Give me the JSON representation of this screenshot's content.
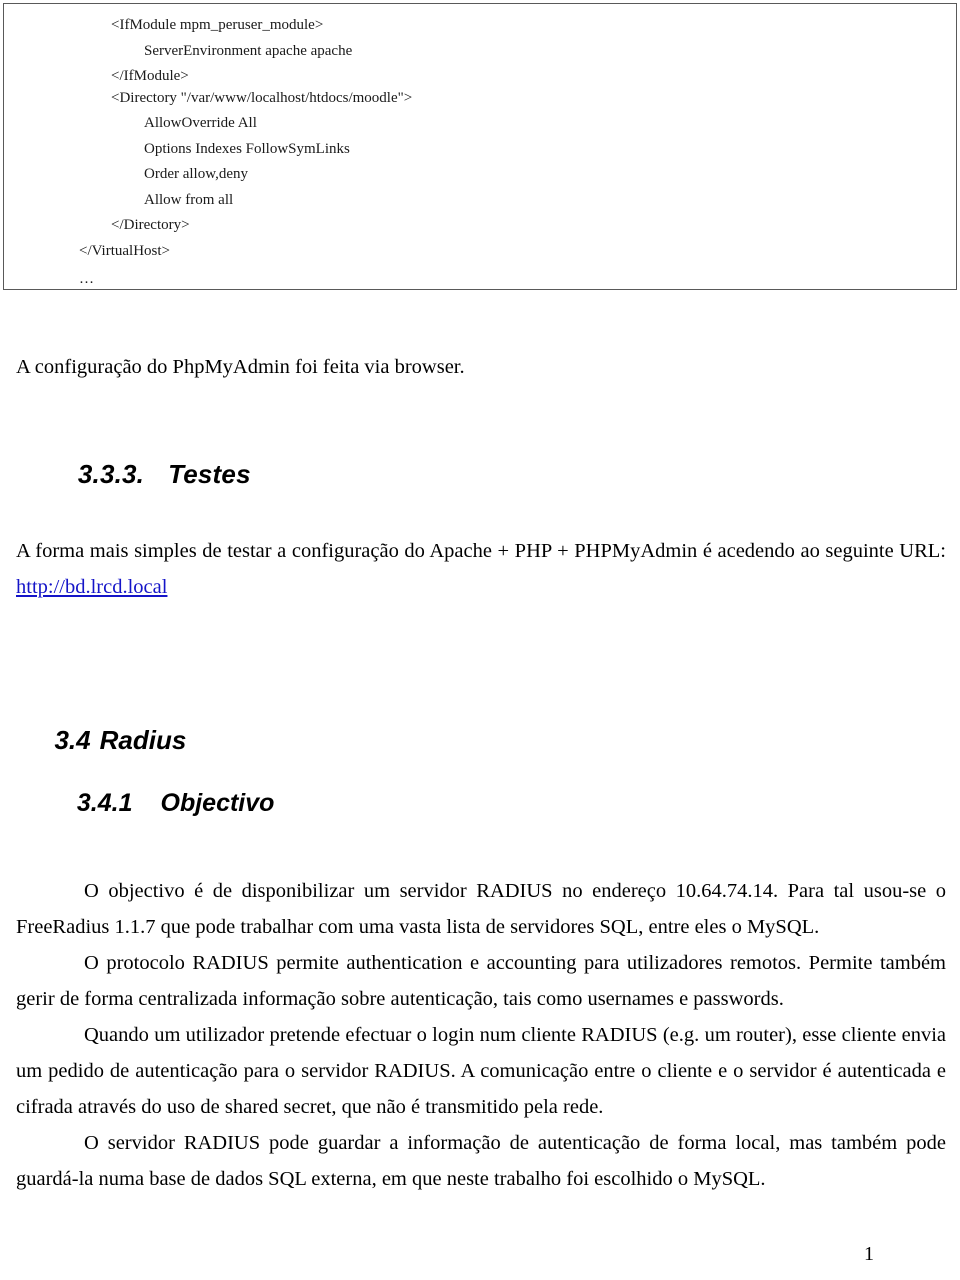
{
  "document": {
    "language": "pt-PT",
    "page_number": "1"
  },
  "code_block": {
    "lines": [
      {
        "text": "<IfModule mpm_peruser_module>",
        "indent": 1
      },
      {
        "text": "ServerEnvironment apache apache",
        "indent": 2
      },
      {
        "text": "</IfModule>",
        "indent": 1
      },
      {
        "text": "<Directory \"/var/www/localhost/htdocs/moodle\">",
        "indent": 1
      },
      {
        "text": "AllowOverride All",
        "indent": 2
      },
      {
        "text": "Options Indexes FollowSymLinks",
        "indent": 2
      },
      {
        "text": "Order allow,deny",
        "indent": 2
      },
      {
        "text": "Allow from all",
        "indent": 2
      },
      {
        "text": "</Directory>",
        "indent": 1
      },
      {
        "text": "</VirtualHost>",
        "indent": 0
      },
      {
        "text": "…",
        "indent": 0
      }
    ]
  },
  "content": {
    "paragraph_phpmyadmin": "A configuração do PhpMyAdmin foi feita via browser.",
    "heading_333": {
      "number": "3.3.3.",
      "title": "Testes"
    },
    "paragraph_testes_before_url": "A forma mais simples de testar a configuração do Apache + PHP + PHPMyAdmin é acedendo ao seguinte URL: ",
    "url_link": "http://bd.lrcd.local",
    "heading_34": {
      "number": "3.4",
      "title": "Radius"
    },
    "heading_341": {
      "number": "3.4.1",
      "title": "Objectivo"
    },
    "paragraph_objectivo": "O objectivo é de disponibilizar um servidor RADIUS no endereço 10.64.74.14. Para tal usou-se o FreeRadius 1.1.7 que pode trabalhar com uma vasta lista de servidores SQL, entre eles o MySQL.",
    "paragraph_protocolo": "O protocolo RADIUS permite authentication e accounting para utilizadores remotos. Permite também gerir de forma centralizada informação sobre autenticação, tais como usernames e passwords.",
    "paragraph_login": "Quando um utilizador pretende efectuar o login num cliente RADIUS (e.g. um router), esse cliente envia um pedido de autenticação para o servidor RADIUS. A comunicação entre o cliente e o servidor é autenticada e cifrada através do uso de shared secret, que não é transmitido pela rede.",
    "paragraph_guardar": "O servidor RADIUS pode guardar a informação de autenticação de forma local, mas também pode guardá-la numa base de dados SQL externa, em que neste trabalho foi escolhido o MySQL."
  },
  "colors": {
    "link": "#1414c8",
    "code_border": "#595959",
    "text": "#000000",
    "page_background": "#ffffff"
  }
}
